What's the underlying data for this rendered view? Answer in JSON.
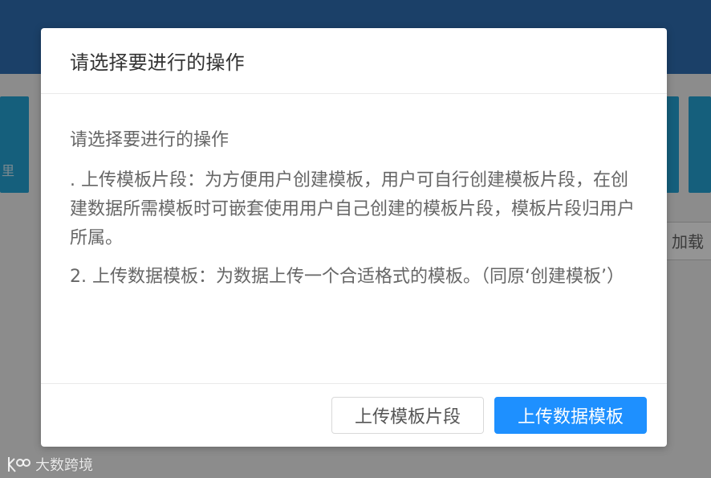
{
  "background": {
    "card_text": "里",
    "load_button_label": "加载"
  },
  "dialog": {
    "title": "请选择要进行的操作",
    "body": {
      "line1": "请选择要进行的操作",
      "item1": ". 上传模板片段：为方便用户创建模板，用户可自行创建模板片段，在创建数据所需模板时可嵌套使用用户自己创建的模板片段，模板片段归用户所属。",
      "item2": "2. 上传数据模板：为数据上传一个合适格式的模板。（同原‘创建模板’）"
    },
    "buttons": {
      "upload_fragment": "上传模板片段",
      "upload_data_template": "上传数据模板"
    }
  },
  "watermark": {
    "text": "大数跨境"
  },
  "colors": {
    "header_bg": "#2f6fb3",
    "accent": "#1e90ff",
    "card_bg": "#25a4d6",
    "overlay": "rgba(0,0,0,0.42)"
  },
  "icons": {
    "watermark_logo": "k100-logo-icon"
  }
}
